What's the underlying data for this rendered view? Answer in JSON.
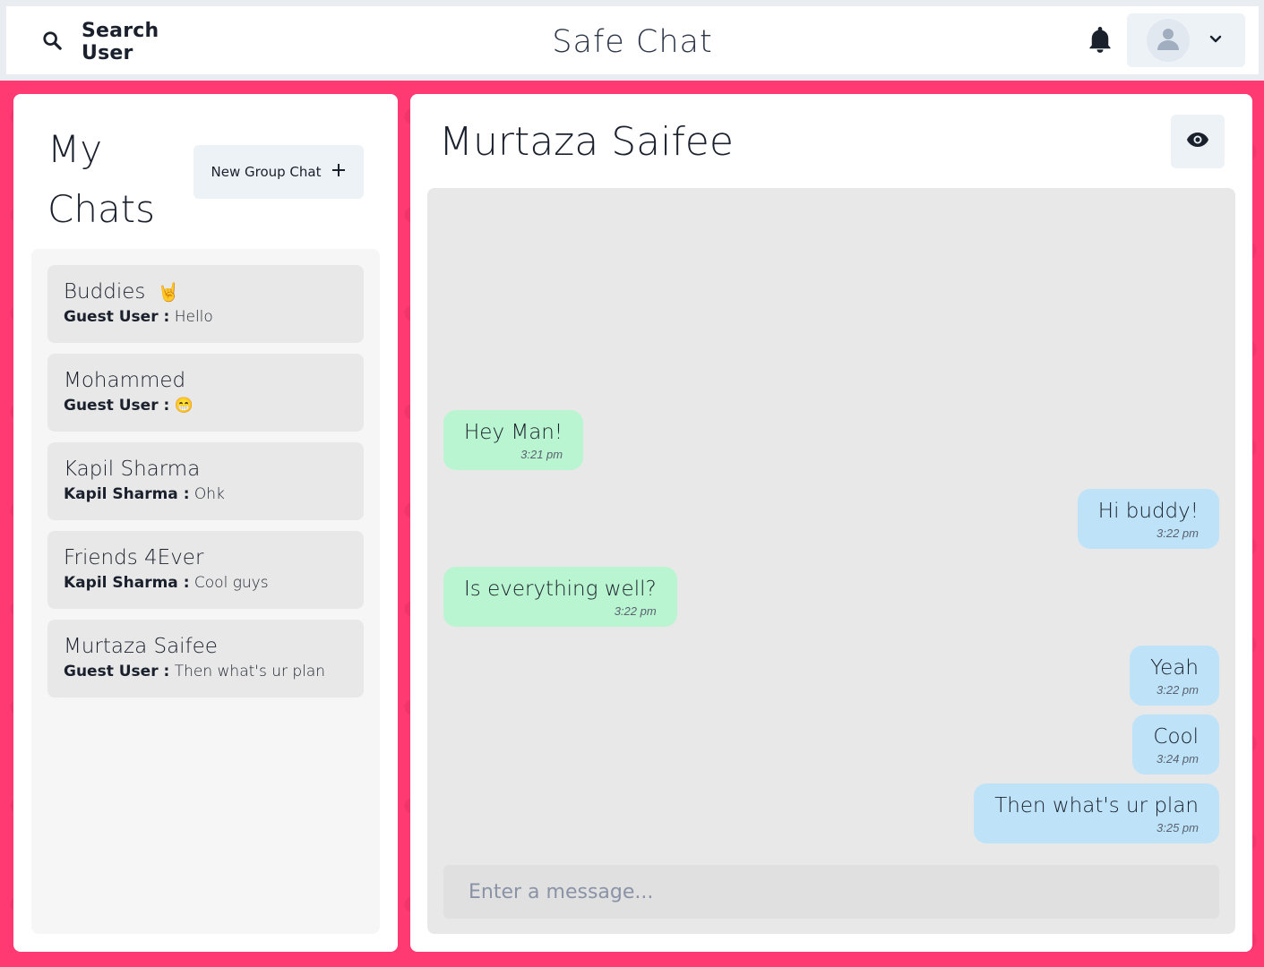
{
  "header": {
    "search_label": "Search User",
    "app_title": "Safe Chat"
  },
  "sidebar": {
    "title_line1": "My",
    "title_line2": "Chats",
    "new_group_label": "New Group Chat",
    "chats": [
      {
        "name": "Buddies",
        "emoji": "🤘",
        "sender": "Guest User :",
        "preview": "Hello"
      },
      {
        "name": "Mohammed",
        "emoji": "",
        "sender": "Guest User :",
        "preview": "😁"
      },
      {
        "name": "Kapil Sharma",
        "emoji": "",
        "sender": "Kapil Sharma :",
        "preview": "Ohk"
      },
      {
        "name": "Friends 4Ever",
        "emoji": "",
        "sender": "Kapil Sharma :",
        "preview": "Cool guys"
      },
      {
        "name": "Murtaza Saifee",
        "emoji": "",
        "sender": "Guest User :",
        "preview": "Then what's ur plan"
      }
    ]
  },
  "conversation": {
    "name": "Murtaza Saifee",
    "input_placeholder": "Enter a message...",
    "messages": [
      {
        "text": "Hey Man!",
        "time": "3:21 pm",
        "direction": "received"
      },
      {
        "text": "Hi buddy!",
        "time": "3:22 pm",
        "direction": "sent"
      },
      {
        "text": "Is everything well?",
        "time": "3:22 pm",
        "direction": "received"
      },
      {
        "text": "Yeah",
        "time": "3:22 pm",
        "direction": "sent"
      },
      {
        "text": "Cool",
        "time": "3:24 pm",
        "direction": "sent"
      },
      {
        "text": "Then what's ur plan",
        "time": "3:25 pm",
        "direction": "sent"
      }
    ]
  },
  "colors": {
    "background": "#ff3a72",
    "received_bubble": "#b9f5d0",
    "sent_bubble": "#bee3f8",
    "button_bg": "#edf2f7"
  },
  "icons": {
    "search": "search-icon",
    "bell": "bell-icon",
    "avatar": "user-avatar-icon",
    "chevron": "chevron-down-icon",
    "plus": "plus-icon",
    "eye": "eye-icon"
  }
}
